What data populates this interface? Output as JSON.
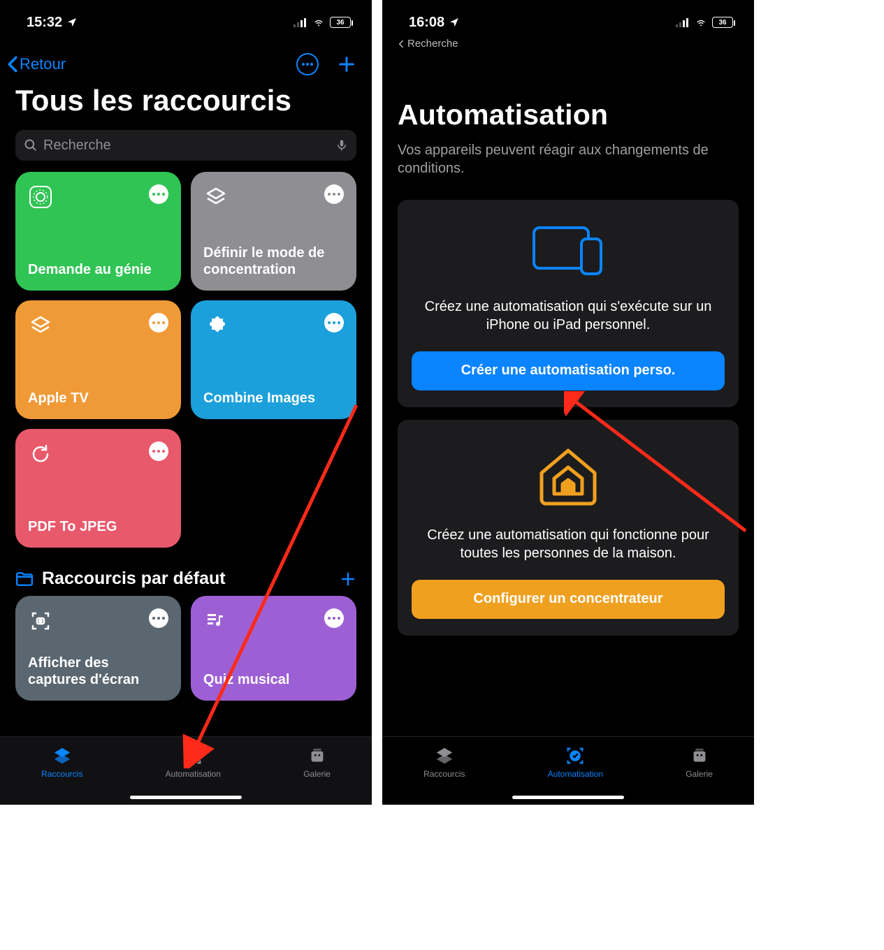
{
  "left": {
    "status": {
      "time": "15:32",
      "battery": "36"
    },
    "nav": {
      "back": "Retour"
    },
    "title": "Tous les raccourcis",
    "search": {
      "placeholder": "Recherche"
    },
    "cards": [
      {
        "label": "Demande au génie"
      },
      {
        "label": "Définir le mode de concentration"
      },
      {
        "label": "Apple TV"
      },
      {
        "label": "Combine Images"
      },
      {
        "label": "PDF To JPEG"
      }
    ],
    "section": {
      "title": "Raccourcis par défaut"
    },
    "default_cards": [
      {
        "label": "Afficher des captures d'écran"
      },
      {
        "label": "Quiz musical"
      }
    ],
    "tabs": {
      "shortcuts": "Raccourcis",
      "automation": "Automatisation",
      "gallery": "Galerie"
    }
  },
  "right": {
    "status": {
      "time": "16:08",
      "battery": "36"
    },
    "breadcrumb": "Recherche",
    "title": "Automatisation",
    "subtitle": "Vos appareils peuvent réagir aux changements de conditions.",
    "personal": {
      "desc": "Créez une automatisation qui s'exécute sur un iPhone ou iPad personnel.",
      "cta": "Créer une automatisation perso."
    },
    "home": {
      "desc": "Créez une automatisation qui fonctionne pour toutes les personnes de la maison.",
      "cta": "Configurer un concentrateur"
    },
    "tabs": {
      "shortcuts": "Raccourcis",
      "automation": "Automatisation",
      "gallery": "Galerie"
    }
  }
}
